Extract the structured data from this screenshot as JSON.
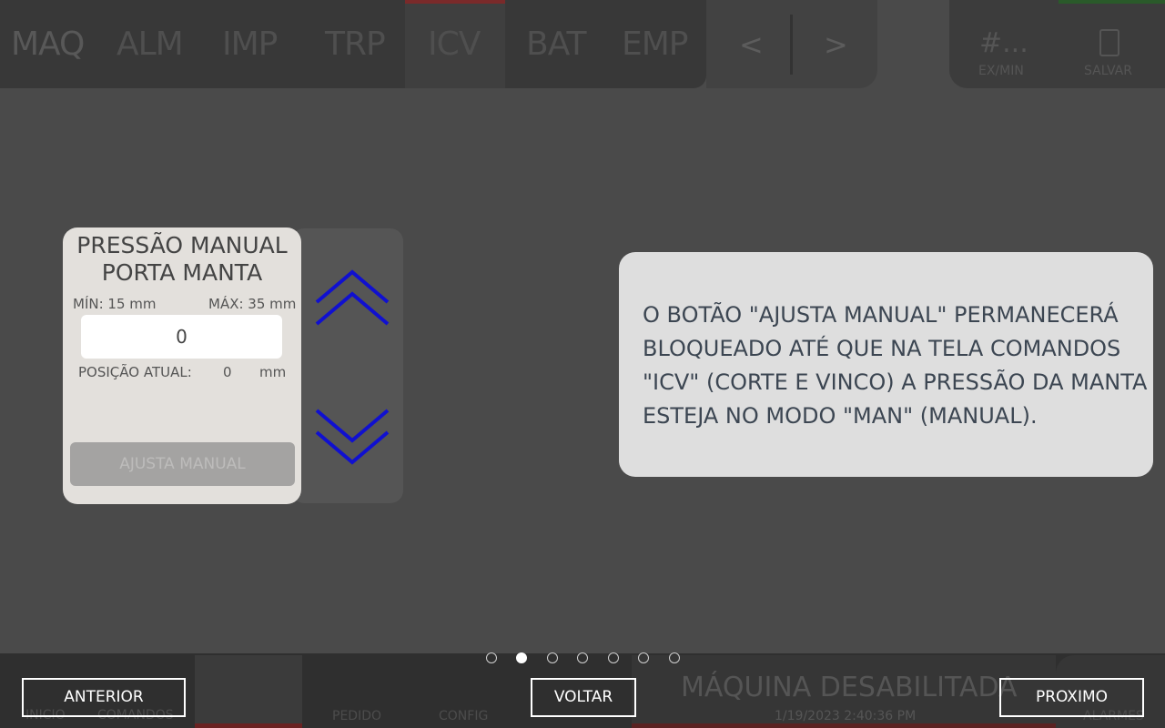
{
  "top_tabs": [
    "MAQ",
    "ALM",
    "IMP",
    "TRP",
    "ICV",
    "BAT",
    "EMP"
  ],
  "nav": {
    "prev": "<",
    "next": ">"
  },
  "counter": {
    "value": "#...",
    "unit": "EX/MIN"
  },
  "save_label": "SALVAR",
  "card": {
    "title_line1": "PRESSÃO MANUAL",
    "title_line2": "PORTA MANTA",
    "min_label": "MÍN: 15 mm",
    "max_label": "MÁX: 35 mm",
    "input_value": "0",
    "position_label": "POSIÇÃO ATUAL:",
    "position_value": "0",
    "position_unit": "mm",
    "adjust_button": "AJUSTA MANUAL"
  },
  "colors": {
    "chevron": "#1010d0",
    "background": "#4a4a4a"
  },
  "info_text": "O BOTÃO \"AJUSTA MANUAL\" PERMANECERÁ BLOQUEADO ATÉ QUE NA TELA COMANDOS \"ICV\" (CORTE E VINCO) A PRESSÃO DA MANTA ESTEJA NO MODO \"MAN\" (MANUAL).",
  "bottom_ghost": {
    "inicio": "INICIO",
    "comandos": "COMANDOS",
    "pedido": "PEDIDO",
    "config": "CONFIG",
    "alarmes": "ALARMES"
  },
  "machine_status": "MÁQUINA DESABILITADA",
  "timestamp": "1/19/2023 2:40:36 PM",
  "pagination": {
    "total": 7,
    "current": 2
  },
  "buttons": {
    "anterior": "ANTERIOR",
    "voltar": "VOLTAR",
    "proximo": "PROXIMO"
  }
}
